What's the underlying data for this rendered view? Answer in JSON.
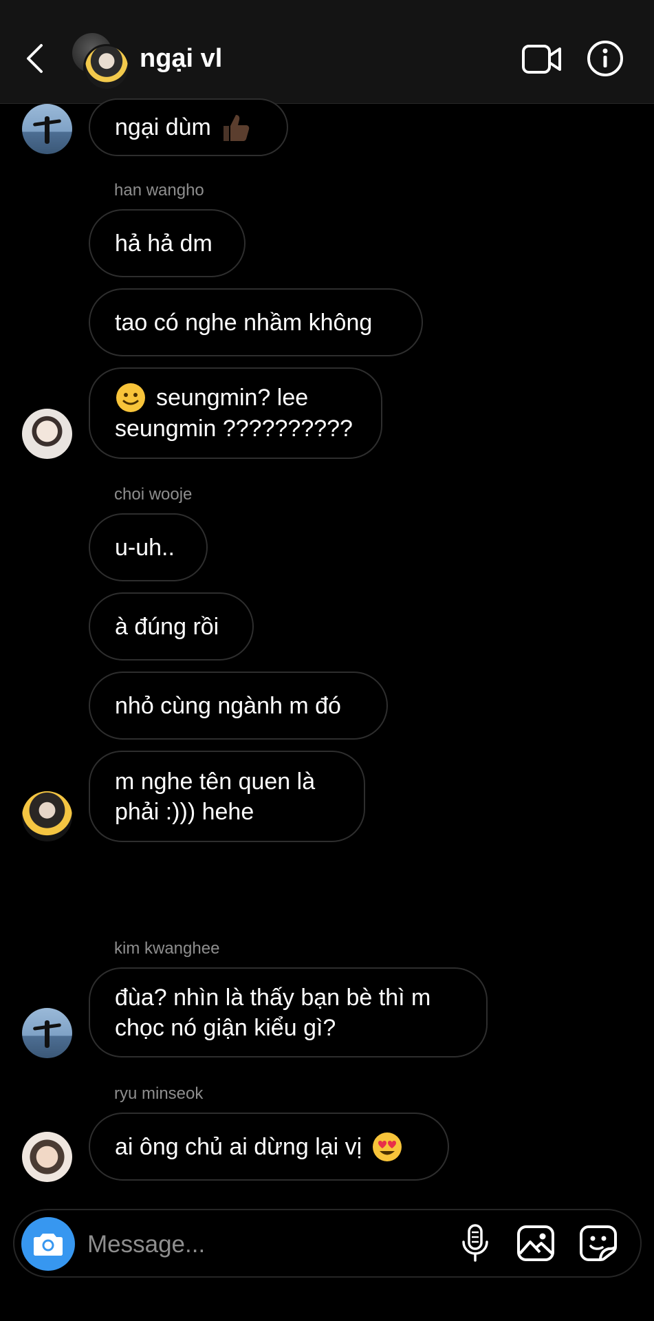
{
  "header": {
    "title": "ngại vl"
  },
  "messages": [
    {
      "text": "ngại dùm",
      "emoji": "thumbs-up-dark-skin"
    },
    {
      "sender": "han wangho"
    },
    {
      "text": "hả hả dm"
    },
    {
      "text": "tao có nghe nhầm không"
    },
    {
      "line1": "seungmin? lee",
      "line2": "seungmin ??????????",
      "emoji": "slightly-smiling-face"
    },
    {
      "sender": "choi wooje"
    },
    {
      "text": "u-uh.."
    },
    {
      "text": "à đúng rồi"
    },
    {
      "text": "nhỏ cùng ngành m đó"
    },
    {
      "line1": "m nghe tên quen là",
      "line2": "phải :))) hehe"
    },
    {
      "sender": "kim kwanghee"
    },
    {
      "line1": "đùa? nhìn là thấy bạn bè thì m",
      "line2": "chọc nó giận kiểu gì?"
    },
    {
      "sender": "ryu minseok"
    },
    {
      "text": "ai ông chủ ai dừng lại vị",
      "emoji": "smiling-face-with-heart-eyes"
    }
  ],
  "composer": {
    "placeholder": "Message..."
  },
  "colors": {
    "background": "#000000",
    "header": "#141414",
    "bubble_border": "#2e2e2e",
    "sender_text": "#8e8e8e",
    "camera_button": "#3797f0"
  },
  "icons": [
    "back-arrow-icon",
    "video-call-icon",
    "info-icon",
    "camera-icon",
    "microphone-icon",
    "gallery-icon",
    "sticker-icon"
  ]
}
